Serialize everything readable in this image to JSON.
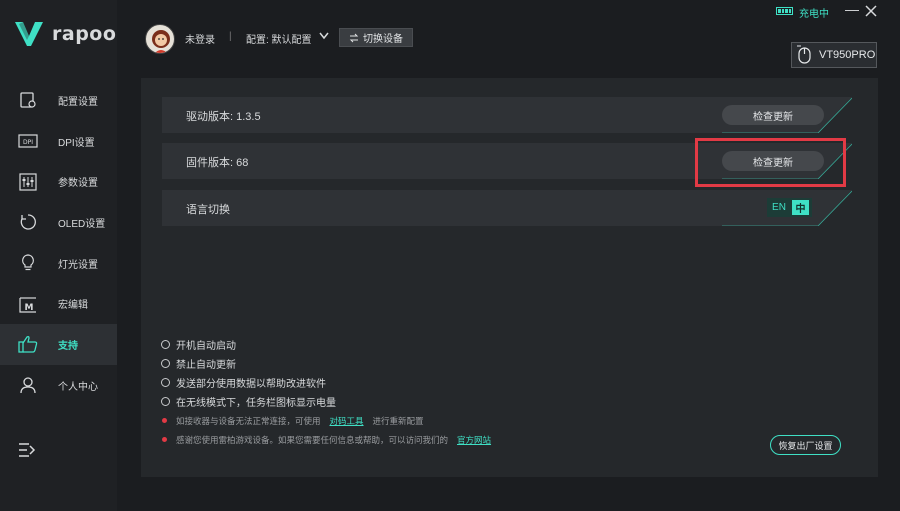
{
  "brand": {
    "logo_text": "rapoo"
  },
  "titlebar": {
    "charging_label": "充电中"
  },
  "sidebar": {
    "items": [
      {
        "label": "配置设置",
        "icon": "config-settings-icon"
      },
      {
        "label": "DPI设置",
        "icon": "dpi-icon"
      },
      {
        "label": "参数设置",
        "icon": "sliders-icon"
      },
      {
        "label": "OLED设置",
        "icon": "oled-icon"
      },
      {
        "label": "灯光设置",
        "icon": "lightbulb-icon"
      },
      {
        "label": "宏编辑",
        "icon": "macro-icon"
      },
      {
        "label": "支持",
        "icon": "thumbs-up-icon",
        "active": true
      },
      {
        "label": "个人中心",
        "icon": "user-icon"
      }
    ]
  },
  "header": {
    "user": "未登录",
    "separator": "|",
    "config_label": "配置: 默认配置",
    "switch_device": "切换设备",
    "device_name": "VT950PRO"
  },
  "settings": {
    "driver_version": "驱动版本: 1.3.5",
    "firmware_version": "固件版本: 68",
    "check_update": "检查更新",
    "language_switch": "语言切换",
    "lang_en": "EN",
    "lang_zh": "中"
  },
  "options": [
    "开机自动启动",
    "禁止自动更新",
    "发送部分使用数据以帮助改进软件",
    "在无线模式下，任务栏图标显示电量"
  ],
  "notes": {
    "note1_before": "如接收器与设备无法正常连接，可使用",
    "note1_link": "对码工具",
    "note1_after": "进行重新配置",
    "note2_before": "感谢您使用雷柏游戏设备。如果您需要任何信息或帮助，可以访问我们的",
    "note2_link": "官方网站"
  },
  "reset_button": "恢复出厂设置",
  "colors": {
    "accent": "#3fe0c5",
    "highlight": "#e23a45",
    "panel": "#25282b"
  }
}
